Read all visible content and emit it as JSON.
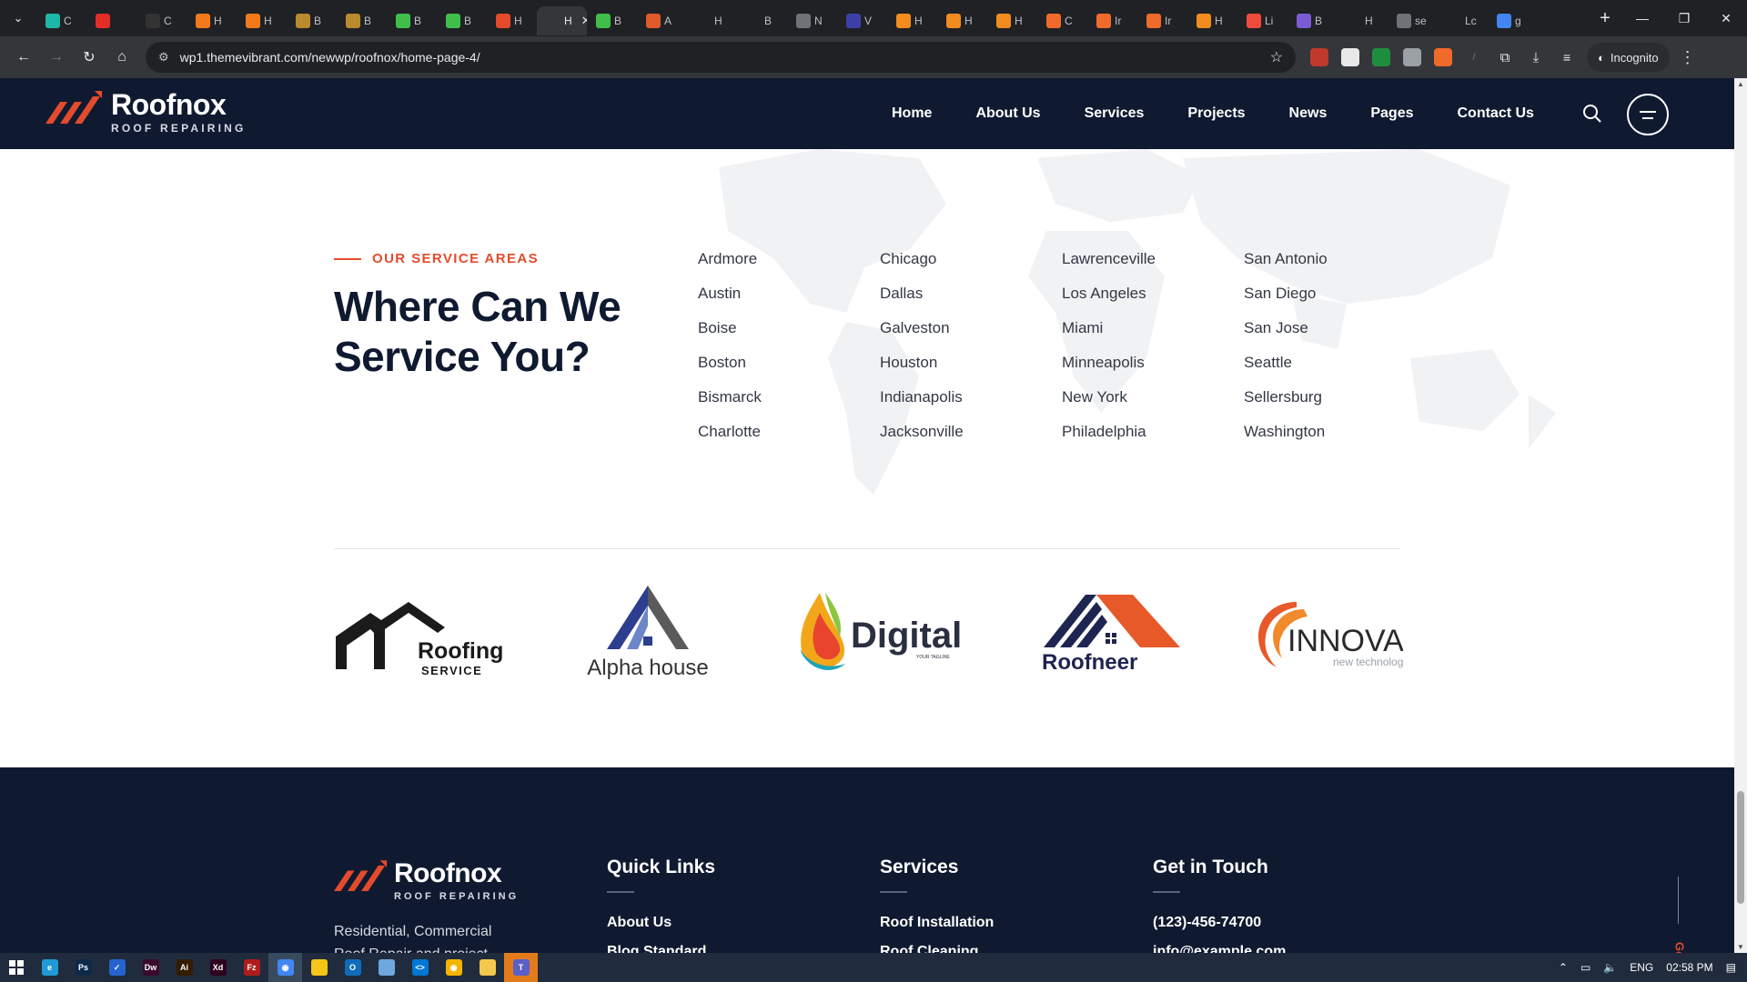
{
  "browser": {
    "tabs": [
      {
        "label": "C",
        "color": "#1eb6a6"
      },
      {
        "label": "",
        "color": "#e52d27"
      },
      {
        "label": "C",
        "color": "#333333"
      },
      {
        "label": "H",
        "color": "#f27a1a"
      },
      {
        "label": "H",
        "color": "#f27a1a"
      },
      {
        "label": "B",
        "color": "#b98a2e"
      },
      {
        "label": "B",
        "color": "#b98a2e"
      },
      {
        "label": "B",
        "color": "#3fbf4a"
      },
      {
        "label": "B",
        "color": "#3fbf4a"
      },
      {
        "label": "H",
        "color": "#e44b2c"
      },
      {
        "label": "H",
        "color": "#35363a",
        "active": true
      },
      {
        "label": "B",
        "color": "#3fbf4a"
      },
      {
        "label": "A",
        "color": "#e05a2b"
      },
      {
        "label": "H",
        "color": "#202124"
      },
      {
        "label": "B",
        "color": "#202124"
      },
      {
        "label": "N",
        "color": "#6f7378"
      },
      {
        "label": "V",
        "color": "#3d3fa8"
      },
      {
        "label": "H",
        "color": "#f28c1f"
      },
      {
        "label": "H",
        "color": "#f28c1f"
      },
      {
        "label": "H",
        "color": "#f28c1f"
      },
      {
        "label": "C",
        "color": "#f06a2b"
      },
      {
        "label": "Ir",
        "color": "#f06a2b"
      },
      {
        "label": "Ir",
        "color": "#f06a2b"
      },
      {
        "label": "H",
        "color": "#f28c1f"
      },
      {
        "label": "Li",
        "color": "#f04a3a"
      },
      {
        "label": "B",
        "color": "#7b5cd6"
      },
      {
        "label": "H",
        "color": "#202124"
      },
      {
        "label": "se",
        "color": "#6f7378"
      },
      {
        "label": "Lc",
        "color": "#202124"
      },
      {
        "label": "g",
        "color": "#4285f4"
      }
    ],
    "url": "wp1.themevibrant.com/newwp/roofnox/home-page-4/",
    "incognito_label": "Incognito",
    "icons": [
      "menu-icon",
      "back-icon",
      "forward-icon",
      "reload-icon",
      "home-icon",
      "star-icon",
      "extensions-icon",
      "download-icon",
      "kebab-icon"
    ]
  },
  "site": {
    "logo_name": "Roofnox",
    "logo_sub": "ROOF REPAIRING",
    "nav": [
      "Home",
      "About Us",
      "Services",
      "Projects",
      "News",
      "Pages",
      "Contact Us"
    ]
  },
  "service_areas": {
    "kicker": "OUR SERVICE AREAS",
    "title": "Where Can We Service You?",
    "columns": [
      [
        "Ardmore",
        "Austin",
        "Boise",
        "Boston",
        "Bismarck",
        "Charlotte"
      ],
      [
        "Chicago",
        "Dallas",
        "Galveston",
        "Houston",
        "Indianapolis",
        "Jacksonville"
      ],
      [
        "Lawrenceville",
        "Los Angeles",
        "Miami",
        "Minneapolis",
        "New York",
        "Philadelphia"
      ],
      [
        "San Antonio",
        "San Diego",
        "San Jose",
        "Seattle",
        "Sellersburg",
        "Washington"
      ]
    ]
  },
  "brands": {
    "roofing": {
      "line1": "Roofing",
      "line2": "SERVICE"
    },
    "alpha": {
      "name": "Alpha house"
    },
    "digital": {
      "name": "Digital",
      "tag": "YOUR TAGLINE"
    },
    "roofneer": {
      "name": "Roofneer"
    },
    "innova": {
      "name": "INNOVA",
      "tag": "new technology"
    }
  },
  "footer": {
    "about": "Residential, Commercial Roof Repair and project",
    "quick_links": {
      "heading": "Quick Links",
      "items": [
        "About Us",
        "Blog Standard"
      ]
    },
    "services": {
      "heading": "Services",
      "items": [
        "Roof Installation",
        "Roof Cleaning"
      ]
    },
    "contact": {
      "heading": "Get in Touch",
      "items": [
        "(123)-456-74700",
        "info@example.com"
      ]
    },
    "goto_top": "Go To Top"
  },
  "taskbar": {
    "apps": [
      {
        "name": "edge",
        "label": "e",
        "color": "#1f9ad6"
      },
      {
        "name": "photoshop",
        "label": "Ps",
        "color": "#0b2a4a"
      },
      {
        "name": "todo",
        "label": "✓",
        "color": "#2564cf"
      },
      {
        "name": "dreamweaver",
        "label": "Dw",
        "color": "#3a0a2d"
      },
      {
        "name": "illustrator",
        "label": "Ai",
        "color": "#331c00"
      },
      {
        "name": "xd",
        "label": "Xd",
        "color": "#2e001f"
      },
      {
        "name": "filezilla",
        "label": "Fz",
        "color": "#b01c1c"
      },
      {
        "name": "chrome",
        "label": "◉",
        "color": "#4285f4",
        "active": true
      },
      {
        "name": "sticky-notes",
        "label": "",
        "color": "#f5c518"
      },
      {
        "name": "outlook",
        "label": "O",
        "color": "#0f6cbd"
      },
      {
        "name": "notepad",
        "label": "",
        "color": "#6fa8dc"
      },
      {
        "name": "vscode",
        "label": "<>",
        "color": "#0078d4"
      },
      {
        "name": "chrome-2",
        "label": "◉",
        "color": "#f4b400"
      },
      {
        "name": "explorer",
        "label": "",
        "color": "#f2c94c"
      },
      {
        "name": "teams",
        "label": "T",
        "color": "#5b5fc7",
        "highlight": true
      }
    ],
    "language": "ENG",
    "time": "02:58 PM"
  }
}
